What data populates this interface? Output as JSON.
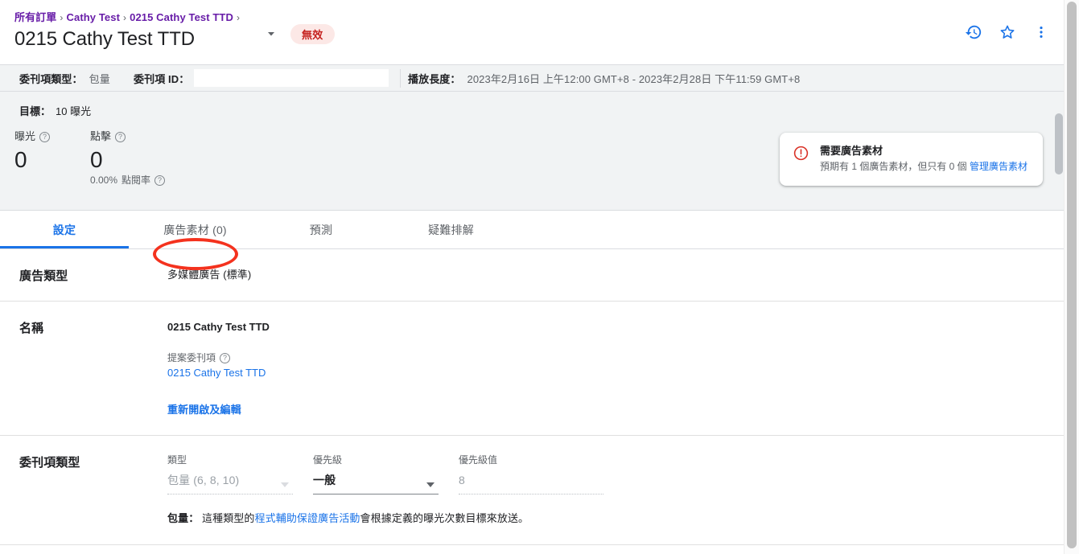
{
  "header": {
    "breadcrumb": [
      {
        "label": "所有訂單"
      },
      {
        "label": "Cathy Test"
      },
      {
        "label": "0215 Cathy Test TTD"
      }
    ],
    "separator": "›",
    "title": "0215 Cathy Test TTD",
    "status_badge": "無效",
    "caret_icon": "chevron-down-icon",
    "actions": [
      {
        "icon": "history-icon"
      },
      {
        "icon": "star-outline-icon"
      },
      {
        "icon": "more-vert-icon"
      }
    ],
    "accent_color": "#1a73e8",
    "breadcrumb_color": "#681da8",
    "badge_text_color": "#c5221f",
    "badge_bg_color": "#fce8e6"
  },
  "infobar": {
    "type_label": "委刊項類型：",
    "type_value": "包量",
    "id_label": "委刊項 ID：",
    "id_value": "",
    "id_placeholder": "",
    "flight_label": "播放長度：",
    "flight_value": "2023年2月16日 上午12:00 GMT+8 - 2023年2月28日 下午11:59 GMT+8"
  },
  "metrics": {
    "goal_label": "目標：",
    "goal_value": "10 曝光",
    "kpis": [
      {
        "label": "曝光",
        "value": "0",
        "help": "help-icon",
        "sub": ""
      },
      {
        "label": "點擊",
        "value": "0",
        "help": "help-icon",
        "sub_value": "0.00%",
        "sub_label": "點閱率"
      }
    ],
    "alert": {
      "icon": "error-circle-icon",
      "icon_color": "#d93025",
      "title": "需要廣告素材",
      "desc_before": "預期有 1 個廣告素材，但只有 0 個 ",
      "link": "管理廣告素材"
    }
  },
  "tabs": {
    "items": [
      {
        "label": "設定",
        "active": true
      },
      {
        "label": "廣告素材 (0)",
        "active": false,
        "annotated": true
      },
      {
        "label": "預測",
        "active": false
      },
      {
        "label": "疑難排解",
        "active": false
      }
    ],
    "annotation_color": "#f4321e"
  },
  "settings": {
    "rows": [
      {
        "label": "廣告類型",
        "value": "多媒體廣告 (標準)"
      },
      {
        "label": "名稱",
        "value": "0215 Cathy Test TTD",
        "sub_label": "提案委刊項",
        "sub_help": "help-icon",
        "sub_link": "0215 Cathy Test TTD",
        "action_link": "重新開啟及編輯"
      },
      {
        "label": "委刊項類型",
        "fields": [
          {
            "label": "類型",
            "value": "包量 (6, 8, 10)",
            "state": "disabled",
            "caret": "chevron-down-icon"
          },
          {
            "label": "優先級",
            "value": "一般",
            "state": "enabled",
            "caret": "chevron-down-icon"
          },
          {
            "label": "優先級值",
            "value": "8",
            "state": "placeholder",
            "caret": ""
          }
        ],
        "note_label": "包量：",
        "note_before": " 這種類型的",
        "note_link": "程式輔助保證廣告活動",
        "note_after": "會根據定義的曝光次數目標來放送。"
      }
    ]
  }
}
